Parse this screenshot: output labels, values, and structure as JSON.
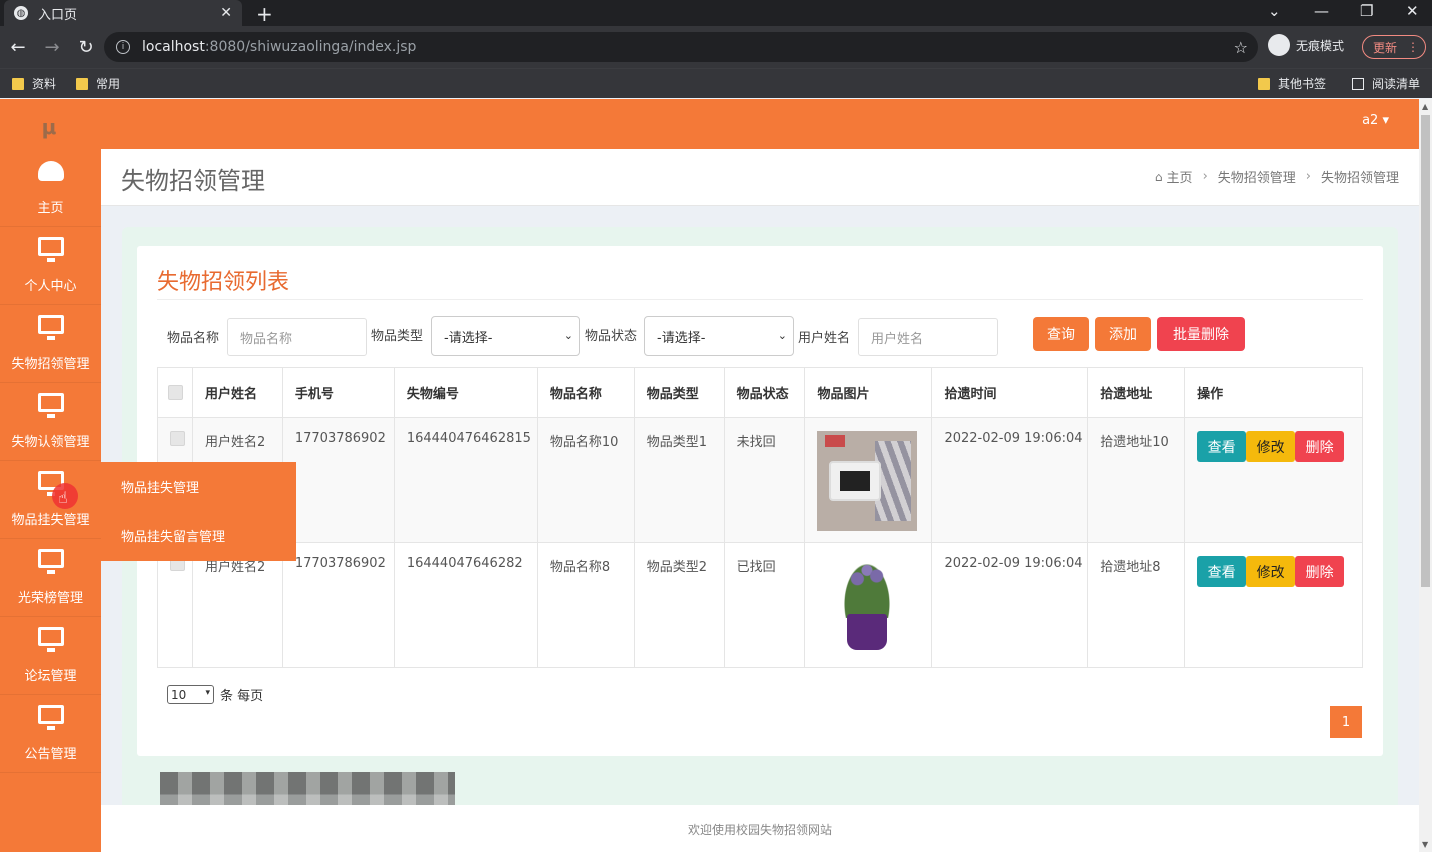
{
  "browser": {
    "tab_title": "入口页",
    "tab_close": "✕",
    "new_tab": "+",
    "url_host": "localhost",
    "url_path": ":8080/shiwuzaolinga/index.jsp",
    "incognito_label": "无痕模式",
    "update_label": "更新",
    "bookmarks": [
      "资料",
      "常用"
    ],
    "bookmarks_right": [
      "其他书签",
      "阅读清单"
    ]
  },
  "app": {
    "user": "a2 ▾",
    "sidebar": [
      {
        "label": "主页",
        "icon": "dashboard-icon"
      },
      {
        "label": "个人中心",
        "icon": "monitor-icon"
      },
      {
        "label": "失物招领管理",
        "icon": "monitor-icon"
      },
      {
        "label": "失物认领管理",
        "icon": "monitor-icon"
      },
      {
        "label": "物品挂失管理",
        "icon": "monitor-icon"
      },
      {
        "label": "光荣榜管理",
        "icon": "monitor-icon"
      },
      {
        "label": "论坛管理",
        "icon": "monitor-icon"
      },
      {
        "label": "公告管理",
        "icon": "monitor-icon"
      }
    ],
    "submenu": [
      "物品挂失管理",
      "物品挂失留言管理"
    ],
    "page_title": "失物招领管理",
    "breadcrumb": [
      "主页",
      "失物招领管理",
      "失物招领管理"
    ],
    "panel_title": "失物招领列表",
    "filters": {
      "name_label": "物品名称",
      "name_placeholder": "物品名称",
      "type_label": "物品类型",
      "type_value": "-请选择-",
      "status_label": "物品状态",
      "status_value": "-请选择-",
      "user_label": "用户姓名",
      "user_placeholder": "用户姓名"
    },
    "buttons": {
      "query": "查询",
      "add": "添加",
      "batch_delete": "批量删除"
    },
    "table": {
      "headers": [
        "用户姓名",
        "手机号",
        "失物编号",
        "物品名称",
        "物品类型",
        "物品状态",
        "物品图片",
        "拾遗时间",
        "拾遗地址",
        "操作"
      ],
      "rows": [
        {
          "user": "用户姓名2",
          "phone": "17703786902",
          "code": "164440476462815",
          "name": "物品名称10",
          "type": "物品类型1",
          "status": "未找回",
          "image": "tablet-photo",
          "time": "2022-02-09 19:06:04",
          "addr": "拾遗地址10"
        },
        {
          "user": "用户姓名2",
          "phone": "17703786902",
          "code": "16444047646282",
          "name": "物品名称8",
          "type": "物品类型2",
          "status": "已找回",
          "image": "plant-photo",
          "time": "2022-02-09 19:06:04",
          "addr": "拾遗地址8"
        }
      ],
      "actions": {
        "view": "查看",
        "edit": "修改",
        "delete": "删除"
      }
    },
    "pagination": {
      "page_size": "10",
      "page_size_suffix": "条 每页",
      "current_page": "1"
    },
    "footer": "欢迎使用校园失物招领网站"
  }
}
